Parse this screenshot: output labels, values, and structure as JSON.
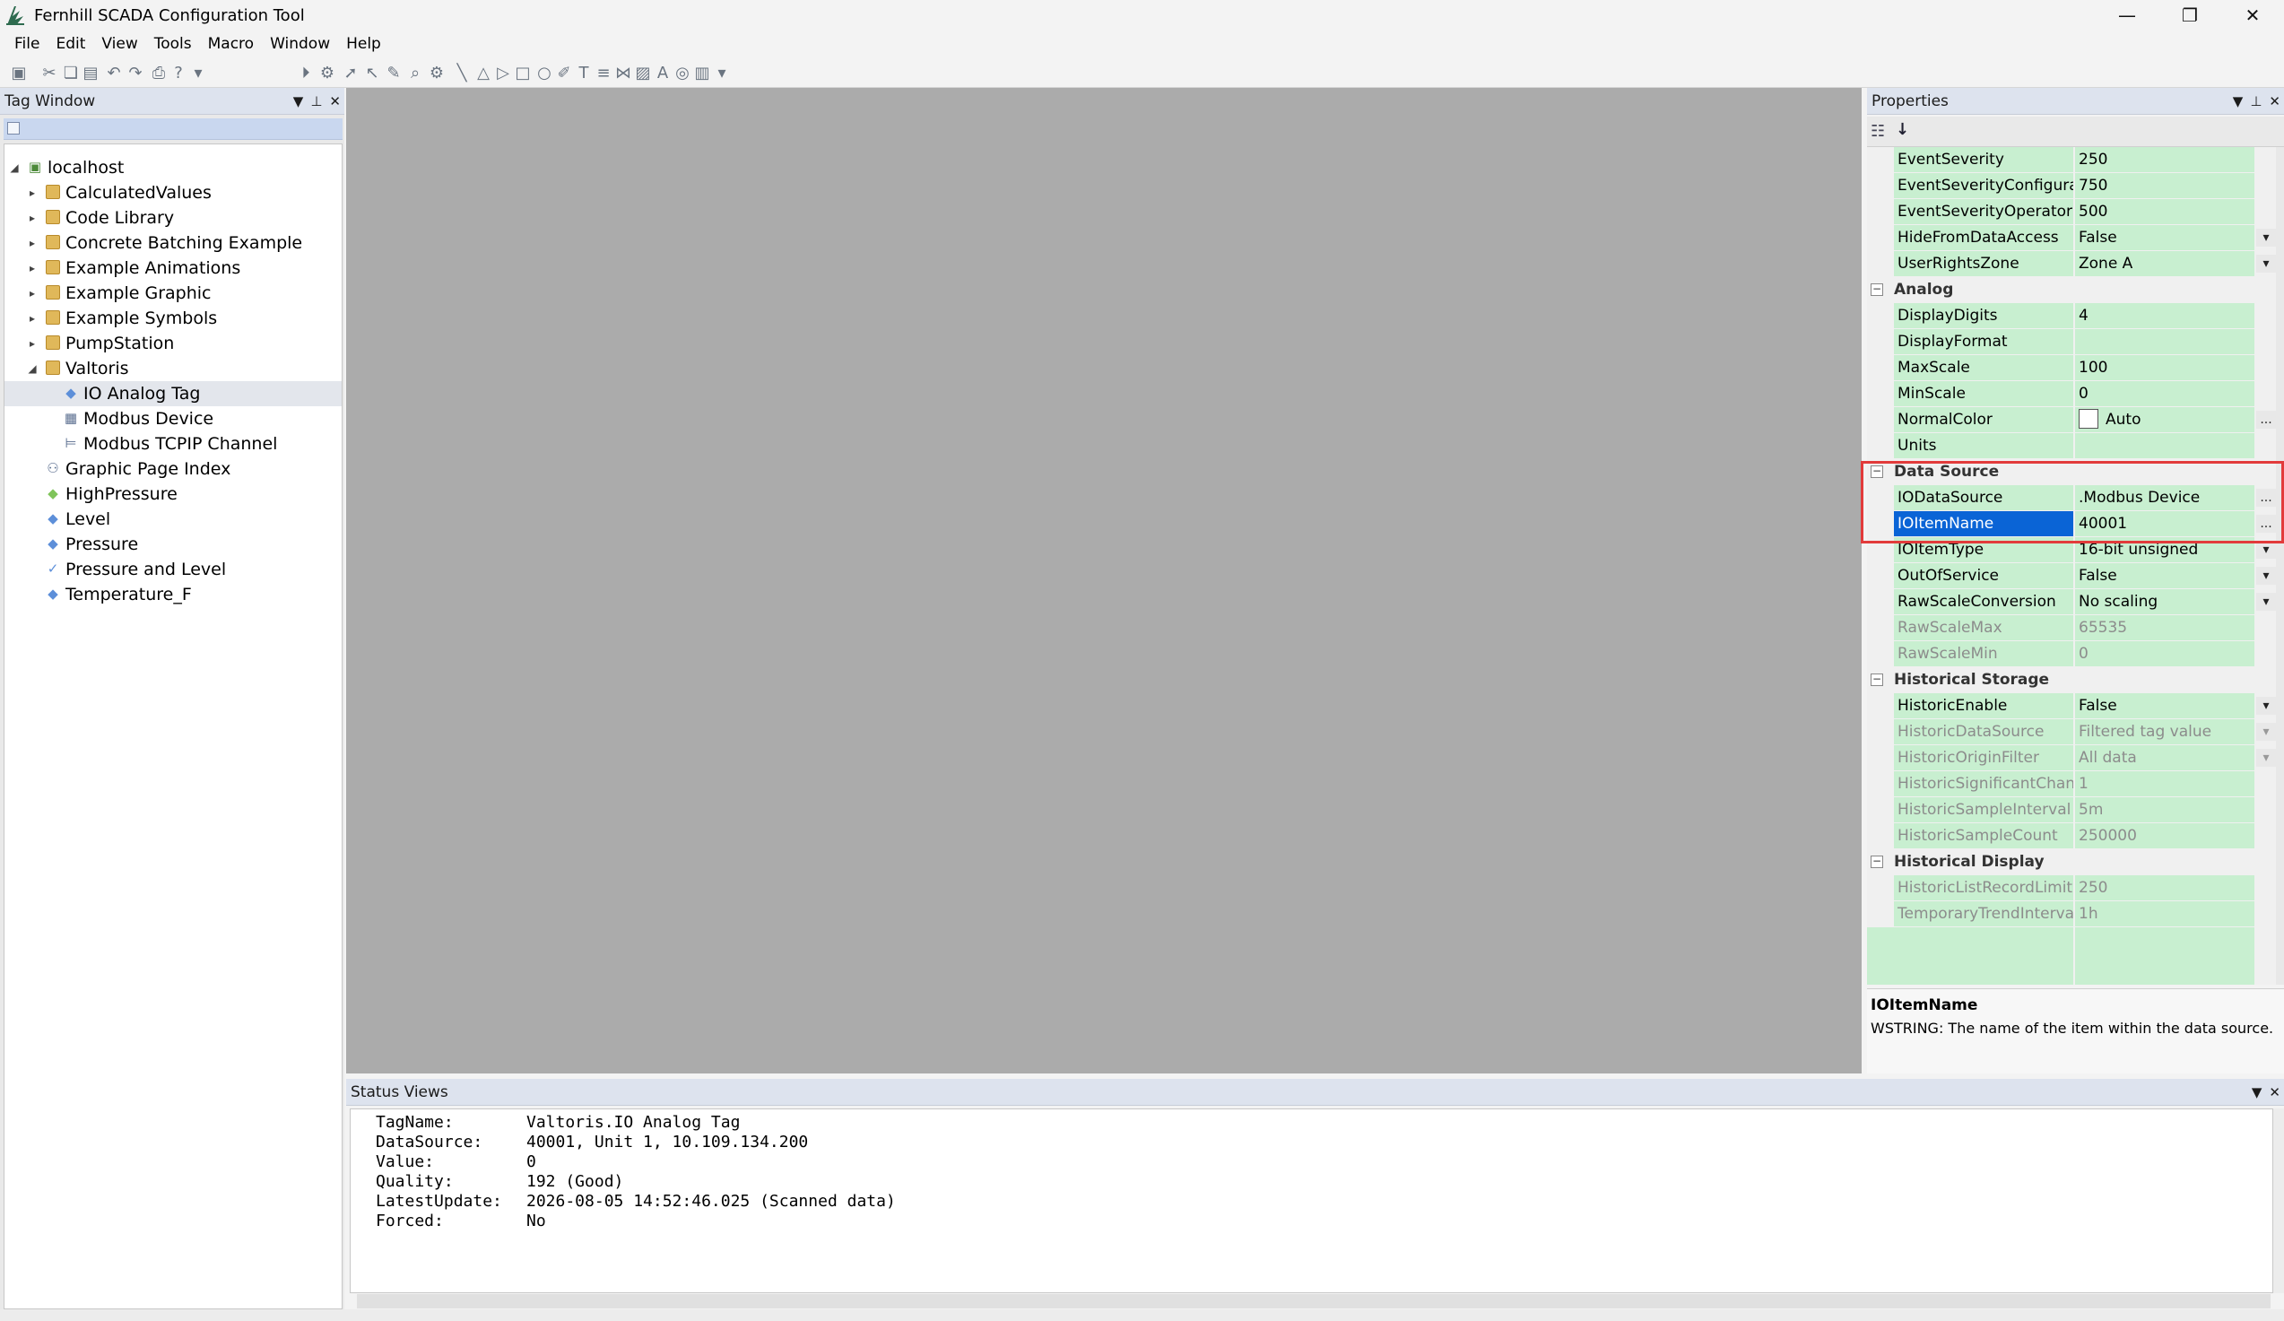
{
  "window": {
    "title": "Fernhill SCADA Configuration Tool",
    "minimize": "—",
    "restore": "❐",
    "close": "✕"
  },
  "menu": [
    "File",
    "Edit",
    "View",
    "Tools",
    "Macro",
    "Window",
    "Help"
  ],
  "tag_window": {
    "title": "Tag Window",
    "tree": [
      {
        "label": "localhost",
        "level": 0,
        "expander": "◢",
        "icon": "server"
      },
      {
        "label": "CalculatedValues",
        "level": 1,
        "expander": "▸",
        "icon": "folder"
      },
      {
        "label": "Code Library",
        "level": 1,
        "expander": "▸",
        "icon": "folder"
      },
      {
        "label": "Concrete Batching Example",
        "level": 1,
        "expander": "▸",
        "icon": "folder"
      },
      {
        "label": "Example Animations",
        "level": 1,
        "expander": "▸",
        "icon": "folder"
      },
      {
        "label": "Example Graphic",
        "level": 1,
        "expander": "▸",
        "icon": "folder"
      },
      {
        "label": "Example Symbols",
        "level": 1,
        "expander": "▸",
        "icon": "folder"
      },
      {
        "label": "PumpStation",
        "level": 1,
        "expander": "▸",
        "icon": "folder"
      },
      {
        "label": "Valtoris",
        "level": 1,
        "expander": "◢",
        "icon": "folder"
      },
      {
        "label": "IO Analog Tag",
        "level": 2,
        "expander": "",
        "icon": "tag",
        "selected": true
      },
      {
        "label": "Modbus Device",
        "level": 2,
        "expander": "",
        "icon": "device"
      },
      {
        "label": "Modbus TCPIP Channel",
        "level": 2,
        "expander": "",
        "icon": "channel"
      },
      {
        "label": "Graphic Page Index",
        "level": 1,
        "expander": "",
        "icon": "index"
      },
      {
        "label": "HighPressure",
        "level": 1,
        "expander": "",
        "icon": "tag-green"
      },
      {
        "label": "Level",
        "level": 1,
        "expander": "",
        "icon": "tag"
      },
      {
        "label": "Pressure",
        "level": 1,
        "expander": "",
        "icon": "tag"
      },
      {
        "label": "Pressure and Level",
        "level": 1,
        "expander": "",
        "icon": "calc"
      },
      {
        "label": "Temperature_F",
        "level": 1,
        "expander": "",
        "icon": "tag"
      }
    ]
  },
  "properties": {
    "title": "Properties",
    "rows": [
      {
        "kind": "prop",
        "name": "EventSeverity",
        "value": "250"
      },
      {
        "kind": "prop",
        "name": "EventSeverityConfigurati...",
        "value": "750"
      },
      {
        "kind": "prop",
        "name": "EventSeverityOperator",
        "value": "500"
      },
      {
        "kind": "prop",
        "name": "HideFromDataAccess",
        "value": "False",
        "button": "▾"
      },
      {
        "kind": "prop",
        "name": "UserRightsZone",
        "value": "Zone A",
        "button": "▾"
      },
      {
        "kind": "cat",
        "name": "Analog"
      },
      {
        "kind": "prop",
        "name": "DisplayDigits",
        "value": "4"
      },
      {
        "kind": "prop",
        "name": "DisplayFormat",
        "value": ""
      },
      {
        "kind": "prop",
        "name": "MaxScale",
        "value": "100"
      },
      {
        "kind": "prop",
        "name": "MinScale",
        "value": "0"
      },
      {
        "kind": "prop",
        "name": "NormalColor",
        "value": "Auto",
        "swatch": "#ffffff",
        "button": "..."
      },
      {
        "kind": "prop",
        "name": "Units",
        "value": ""
      },
      {
        "kind": "cat",
        "name": "Data Source"
      },
      {
        "kind": "prop",
        "name": "IODataSource",
        "value": ".Modbus Device",
        "button": "..."
      },
      {
        "kind": "prop",
        "name": "IOItemName",
        "value": "40001",
        "button": "...",
        "selected": true
      },
      {
        "kind": "prop",
        "name": "IOItemType",
        "value": "16-bit unsigned",
        "button": "▾"
      },
      {
        "kind": "prop",
        "name": "OutOfService",
        "value": "False",
        "button": "▾"
      },
      {
        "kind": "prop",
        "name": "RawScaleConversion",
        "value": "No scaling",
        "button": "▾"
      },
      {
        "kind": "prop",
        "name": "RawScaleMax",
        "value": "65535",
        "disabled": true
      },
      {
        "kind": "prop",
        "name": "RawScaleMin",
        "value": "0",
        "disabled": true
      },
      {
        "kind": "cat",
        "name": "Historical Storage"
      },
      {
        "kind": "prop",
        "name": "HistoricEnable",
        "value": "False",
        "button": "▾"
      },
      {
        "kind": "prop",
        "name": "HistoricDataSource",
        "value": "Filtered tag value",
        "button": "▾",
        "disabled": true
      },
      {
        "kind": "prop",
        "name": "HistoricOriginFilter",
        "value": "All data",
        "button": "▾",
        "disabled": true
      },
      {
        "kind": "prop",
        "name": "HistoricSignificantChange",
        "value": "1",
        "disabled": true
      },
      {
        "kind": "prop",
        "name": "HistoricSampleInterval",
        "value": "5m",
        "disabled": true
      },
      {
        "kind": "prop",
        "name": "HistoricSampleCount",
        "value": "250000",
        "disabled": true
      },
      {
        "kind": "cat",
        "name": "Historical Display"
      },
      {
        "kind": "prop",
        "name": "HistoricListRecordLimit",
        "value": "250",
        "disabled": true
      },
      {
        "kind": "prop",
        "name": "TemporaryTrendInterval",
        "value": "1h",
        "disabled": true
      }
    ],
    "description_title": "IOItemName",
    "description_text": "WSTRING: The name of the item within the data source."
  },
  "status_views": {
    "title": "Status Views",
    "lines": [
      {
        "key": "TagName:",
        "value": "Valtoris.IO Analog Tag"
      },
      {
        "key": "DataSource:",
        "value": "40001, Unit 1, 10.109.134.200"
      },
      {
        "key": "Value:",
        "value": "0"
      },
      {
        "key": "Quality:",
        "value": "192 (Good)"
      },
      {
        "key": "LatestUpdate:",
        "value": "2026-08-05 14:52:46.025 (Scanned data)"
      },
      {
        "key": "Forced:",
        "value": "No"
      }
    ]
  },
  "colors": {
    "accent": "#0a64d6",
    "grid_green": "#c8efd0",
    "highlight": "#e23b3b",
    "canvas": "#ababab"
  }
}
